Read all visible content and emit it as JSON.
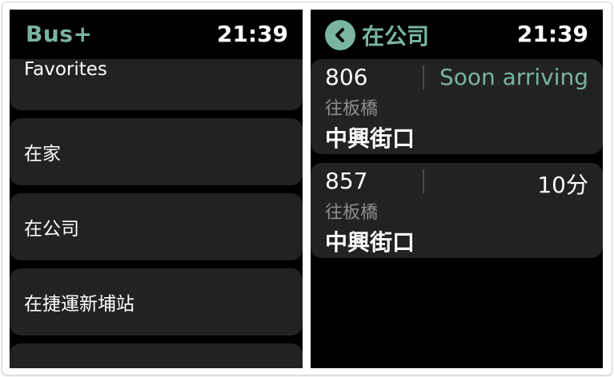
{
  "left_screen": {
    "app_title": "Bus+",
    "time": "21:39",
    "favorites": [
      {
        "label": "Favorites"
      },
      {
        "label": "在家"
      },
      {
        "label": "在公司"
      },
      {
        "label": "在捷運新埔站"
      },
      {
        "label": ""
      }
    ]
  },
  "right_screen": {
    "back_label": "在公司",
    "time": "21:39",
    "arrivals": [
      {
        "route": "806",
        "eta": "Soon arriving",
        "eta_color": "#7ab5a1",
        "direction": "往板橋",
        "stop": "中興街口"
      },
      {
        "route": "857",
        "eta": "10分",
        "eta_color": "#ffffff",
        "direction": "往板橋",
        "stop": "中興街口"
      }
    ]
  },
  "colors": {
    "accent": "#7ab5a1",
    "card_bg": "#222222",
    "screen_bg": "#000000"
  },
  "icons": {
    "back": "chevron-left-circle-icon"
  }
}
